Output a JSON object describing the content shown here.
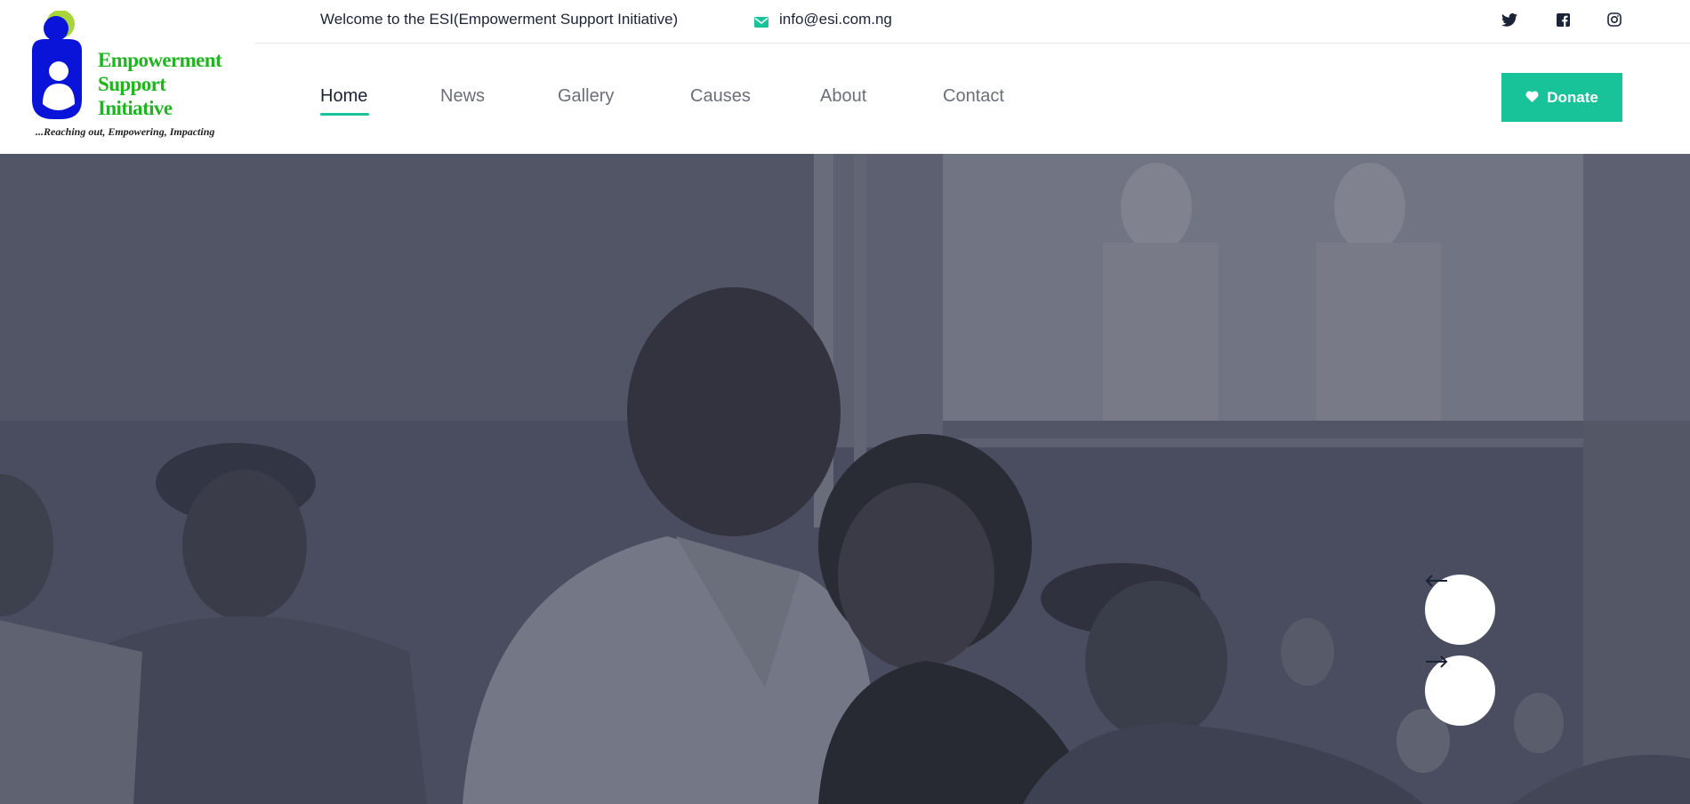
{
  "logo": {
    "line1": "Empowerment",
    "line2": "Support",
    "line3": "Initiative",
    "tagline": "...Reaching out, Empowering, Impacting",
    "colors": {
      "figure": "#0a14d8",
      "head": "#a8d63a",
      "text": "#1fb51f"
    }
  },
  "topbar": {
    "welcome": "Welcome to the ESI(Empowerment Support Initiative)",
    "email": "info@esi.com.ng",
    "email_icon": "envelope-icon",
    "social": [
      "twitter-icon",
      "facebook-icon",
      "instagram-icon"
    ]
  },
  "nav": {
    "items": [
      {
        "label": "Home",
        "active": true
      },
      {
        "label": "News",
        "active": false
      },
      {
        "label": "Gallery",
        "active": false
      },
      {
        "label": "Causes",
        "active": false
      },
      {
        "label": "About",
        "active": false
      },
      {
        "label": "Contact",
        "active": false
      }
    ]
  },
  "donate": {
    "label": "Donate",
    "icon": "heart-icon"
  },
  "hero": {
    "prev_icon": "arrow-left-icon",
    "next_icon": "arrow-right-icon"
  },
  "colors": {
    "accent": "#19c39a",
    "text": "#1b2337",
    "overlay": "#4d5160"
  }
}
